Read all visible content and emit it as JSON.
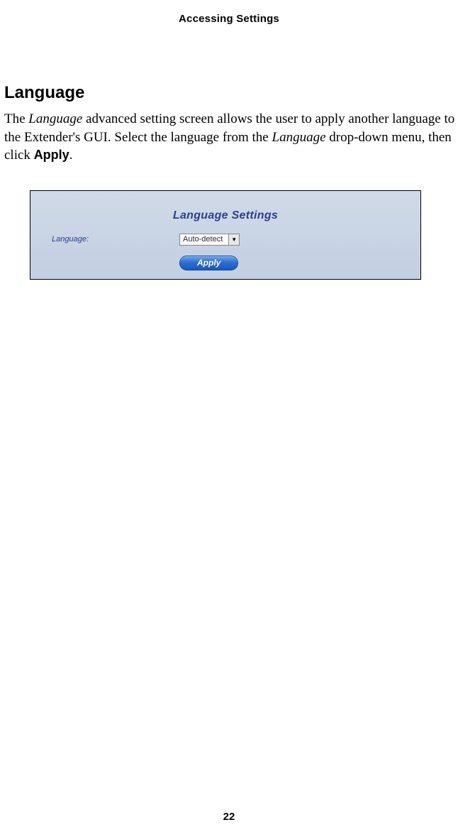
{
  "header": {
    "title": "Accessing Settings"
  },
  "section": {
    "heading": "Language",
    "p_prefix": "The ",
    "p_italic1": "Language",
    "p_mid1": " advanced setting screen allows the user to apply another language to the Extender's GUI. Select the language from the ",
    "p_italic2": "Language",
    "p_mid2": " drop-down menu, then click ",
    "p_bold": "Apply",
    "p_end": "."
  },
  "panel": {
    "title": "Language Settings",
    "label": "Language:",
    "selected_value": "Auto-detect",
    "apply_label": "Apply"
  },
  "footer": {
    "page_number": "22"
  }
}
